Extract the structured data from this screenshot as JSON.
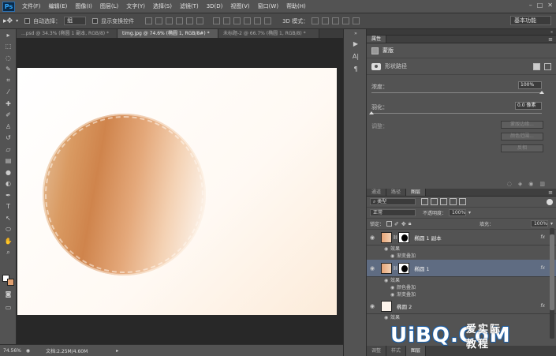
{
  "app": {
    "logo": "Ps"
  },
  "menu": [
    "文件(F)",
    "编辑(E)",
    "图像(I)",
    "图层(L)",
    "文字(Y)",
    "选择(S)",
    "滤镜(T)",
    "3D(D)",
    "视图(V)",
    "窗口(W)",
    "帮助(H)"
  ],
  "options": {
    "auto_select_label": "自动选择：",
    "auto_select_value": "组",
    "show_transform_label": "显示变换控件",
    "mode_3d_label": "3D 模式：",
    "workspace": "基本功能"
  },
  "tabs": [
    {
      "label": "...psd @ 34.3% (椭圆 1 副本, RGB/8) *",
      "active": false
    },
    {
      "label": "timg.jpg @ 74.6% (椭圆 1, RGB/8#) *",
      "active": true
    },
    {
      "label": "未标题-2 @ 66.7% (椭圆 1, RGB/8) *",
      "active": false
    }
  ],
  "status": {
    "zoom": "74.56%",
    "doc": "文档:2.25M/4.60M"
  },
  "properties": {
    "tab": "属性",
    "section": "蒙版",
    "path_label": "形状路径",
    "density_label": "浓度：",
    "density_value": "100%",
    "feather_label": "羽化：",
    "feather_value": "0.0 像素",
    "adjust_label": "调整：",
    "buttons": [
      "蒙版边缘...",
      "颜色范围...",
      "反相"
    ]
  },
  "layers_panel": {
    "tabs": [
      "通道",
      "路径",
      "图层"
    ],
    "filter_type": "类型",
    "blend_mode": "正常",
    "opacity_label": "不透明度：",
    "opacity_value": "100%",
    "lock_label": "锁定：",
    "fill_label": "填充：",
    "fill_value": "100%",
    "layers": [
      {
        "name": "椭圆 1 副本",
        "selected": false,
        "fx": "fx",
        "effects_label": "效果",
        "effects": [
          "渐变叠加"
        ]
      },
      {
        "name": "椭圆 1",
        "selected": true,
        "fx": "fx",
        "effects_label": "效果",
        "effects": [
          "颜色叠加",
          "渐变叠加"
        ]
      },
      {
        "name": "椭圆 2",
        "selected": false,
        "fx": "fx",
        "effects_label": "效果",
        "effects": []
      }
    ]
  },
  "bottom_tabs": [
    "调整",
    "样式",
    "图层"
  ],
  "watermark": {
    "logo": "UiBQ.CoM",
    "sub": "爱实际教程"
  },
  "colors": {
    "accent": "#31a8ff",
    "selected_layer": "#5f6c82",
    "egg": "#d99a62"
  }
}
